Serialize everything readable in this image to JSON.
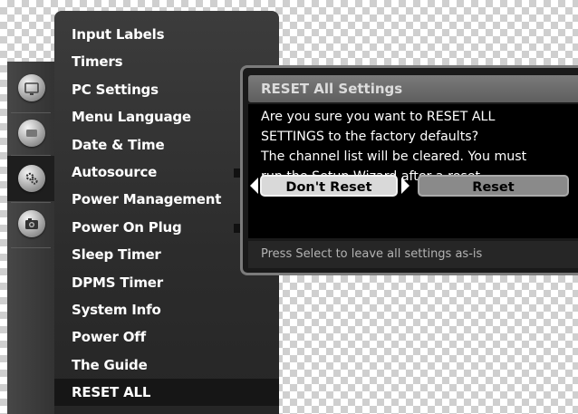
{
  "menu": {
    "items": [
      {
        "label": "Input Labels"
      },
      {
        "label": "Timers"
      },
      {
        "label": "PC Settings"
      },
      {
        "label": "Menu Language"
      },
      {
        "label": "Date & Time"
      },
      {
        "label": "Autosource"
      },
      {
        "label": "Power Management"
      },
      {
        "label": "Power On Plug"
      },
      {
        "label": "Sleep Timer"
      },
      {
        "label": "DPMS Timer"
      },
      {
        "label": "System Info"
      },
      {
        "label": "Power Off"
      },
      {
        "label": "The Guide"
      },
      {
        "label": "RESET ALL"
      }
    ],
    "selected_label": "RESET ALL"
  },
  "sidebar": {
    "icons": [
      {
        "name": "picture-icon"
      },
      {
        "name": "audio-icon"
      },
      {
        "name": "settings-gears-icon",
        "selected": true
      },
      {
        "name": "camera-icon"
      }
    ]
  },
  "dialog": {
    "title": "RESET All Settings",
    "message": [
      "Are you sure you want to RESET ALL",
      "SETTINGS to the factory defaults?",
      "The channel list will be cleared. You must",
      "run the Setup Wizard after a reset."
    ],
    "buttons": {
      "dont_reset": "Don't Reset",
      "reset": "Reset"
    },
    "hint": "Press Select to leave all settings as-is"
  },
  "colors": {
    "panel": "#2c2c2c",
    "selection": "#161616",
    "button_focused": "#d9d9d9",
    "button_unfocused": "#8a8a8a",
    "title_bar": "#6b6b6b"
  }
}
